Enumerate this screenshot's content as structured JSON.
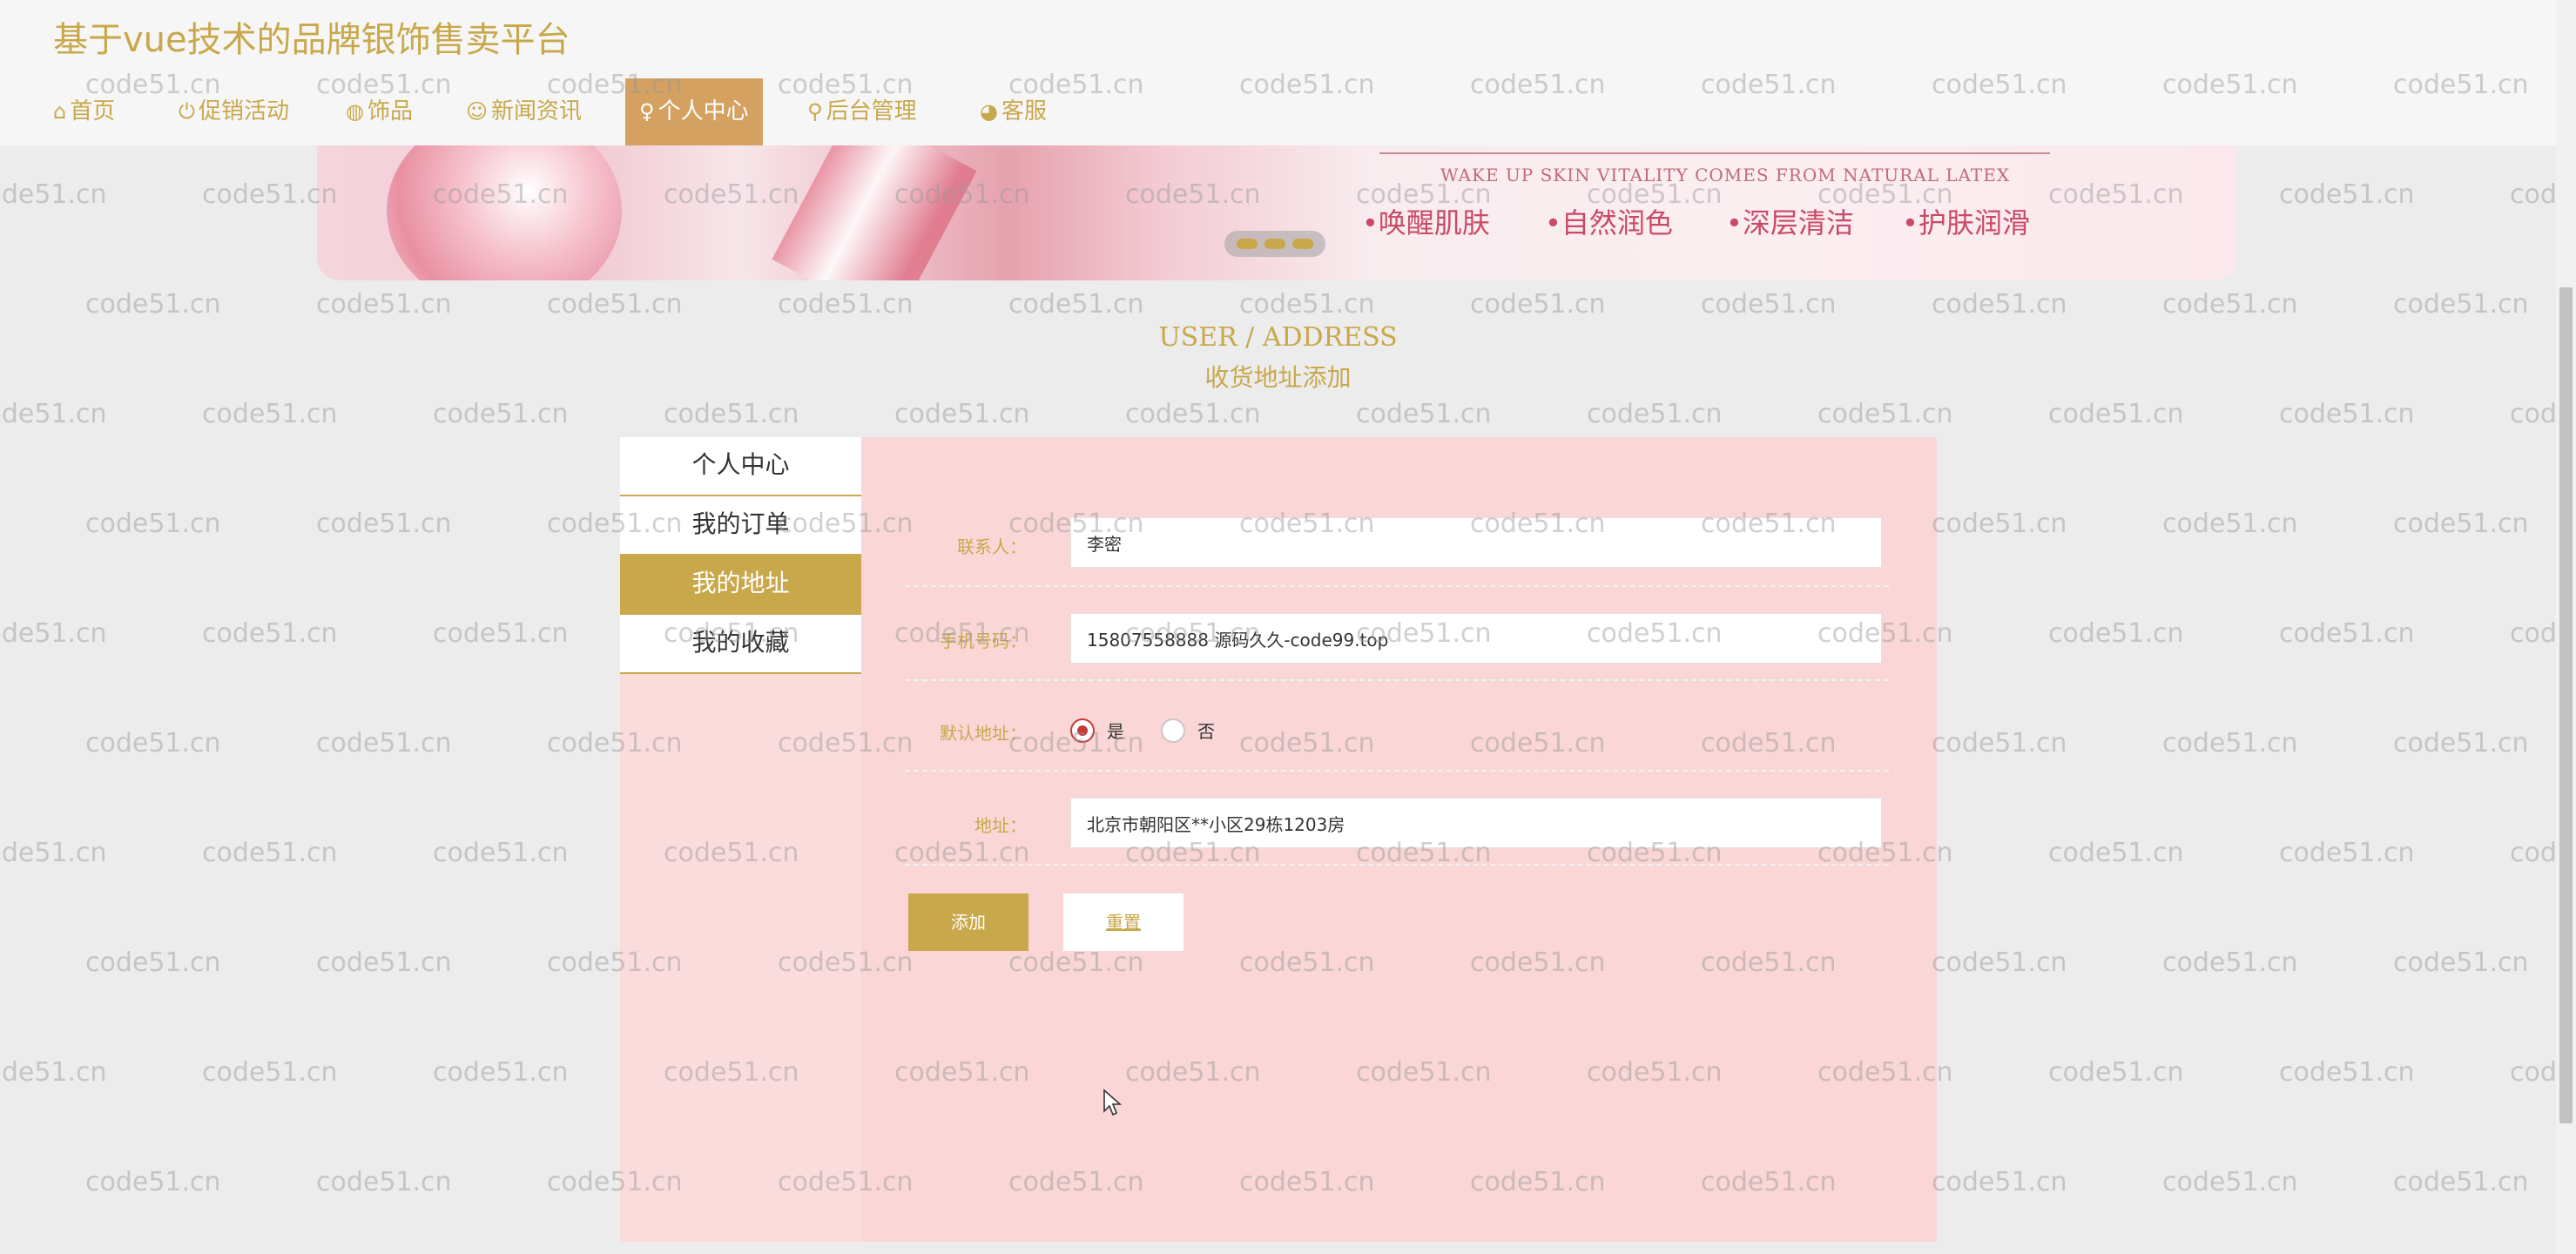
{
  "site_title": "基于vue技术的品牌银饰售卖平台",
  "nav": [
    {
      "label": "首页",
      "icon": "home-icon",
      "glyph": "⌂",
      "active": false
    },
    {
      "label": "促销活动",
      "icon": "power-icon",
      "glyph": "⏻",
      "active": false
    },
    {
      "label": "饰品",
      "icon": "globe-icon",
      "glyph": "◍",
      "active": false
    },
    {
      "label": "新闻资讯",
      "icon": "smile-icon",
      "glyph": "☺",
      "active": false
    },
    {
      "label": "个人中心",
      "icon": "user-icon",
      "glyph": "♀",
      "active": true
    },
    {
      "label": "后台管理",
      "icon": "link-icon",
      "glyph": "⚲",
      "active": false
    },
    {
      "label": "客服",
      "icon": "chat-icon",
      "glyph": "◕",
      "active": false
    }
  ],
  "banner": {
    "tagline": "WAKE UP SKIN VITALITY COMES FROM NATURAL LATEX",
    "features": [
      "•唤醒肌肤",
      "•自然润色",
      "•深层清洁",
      "•护肤润滑"
    ],
    "slide_count": 3
  },
  "page": {
    "en_title": "USER / ADDRESS",
    "cn_title": "收货地址添加"
  },
  "sidebar": {
    "items": [
      {
        "label": "个人中心",
        "active": false
      },
      {
        "label": "我的订单",
        "active": false
      },
      {
        "label": "我的地址",
        "active": true
      },
      {
        "label": "我的收藏",
        "active": false
      }
    ]
  },
  "form": {
    "contact_label": "联系人：",
    "contact_value": "李密",
    "phone_label": "手机号码：",
    "phone_value": "15807558888 源码久久-code99.top",
    "default_label": "默认地址：",
    "default_options": [
      "是",
      "否"
    ],
    "default_selected": "是",
    "address_label": "地址：",
    "address_value": "北京市朝阳区**小区29栋1203房",
    "add_button": "添加",
    "reset_button": "重置"
  },
  "watermark": "code51.cn",
  "colors": {
    "accent": "#c8a84b",
    "nav_active": "#d4a160",
    "panel_bg": "#fad6d6",
    "radio_checked": "#c63a3a"
  }
}
